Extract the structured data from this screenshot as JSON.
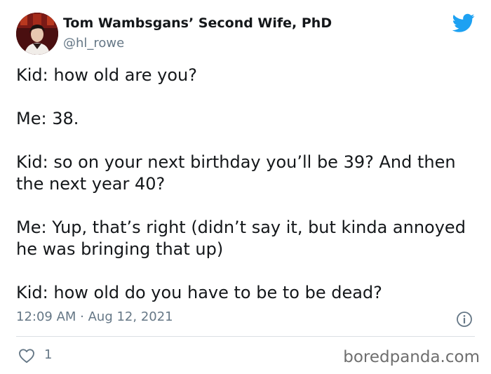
{
  "author": {
    "display_name": "Tom Wambsgans’ Second Wife, PhD",
    "handle": "@hl_rowe",
    "avatar": "user-avatar-photo"
  },
  "tweet": {
    "paragraphs": [
      "Kid: how old are you?",
      "Me: 38.",
      "Kid: so on your next birthday you’ll be 39? And then the next year 40?",
      "Me: Yup, that’s right (didn’t say it, but kinda annoyed he was bringing that up)",
      "Kid: how old do you have to be to be dead?"
    ],
    "timestamp": "12:09 AM · Aug 12, 2021"
  },
  "engagement": {
    "like_count": "1"
  },
  "icons": {
    "logo": "twitter-bird-icon",
    "info": "info-icon",
    "like": "heart-icon"
  },
  "watermark": "boredpanda.com",
  "colors": {
    "twitter_blue": "#1da1f2",
    "secondary_text": "#657786",
    "primary_text": "#14171a"
  }
}
